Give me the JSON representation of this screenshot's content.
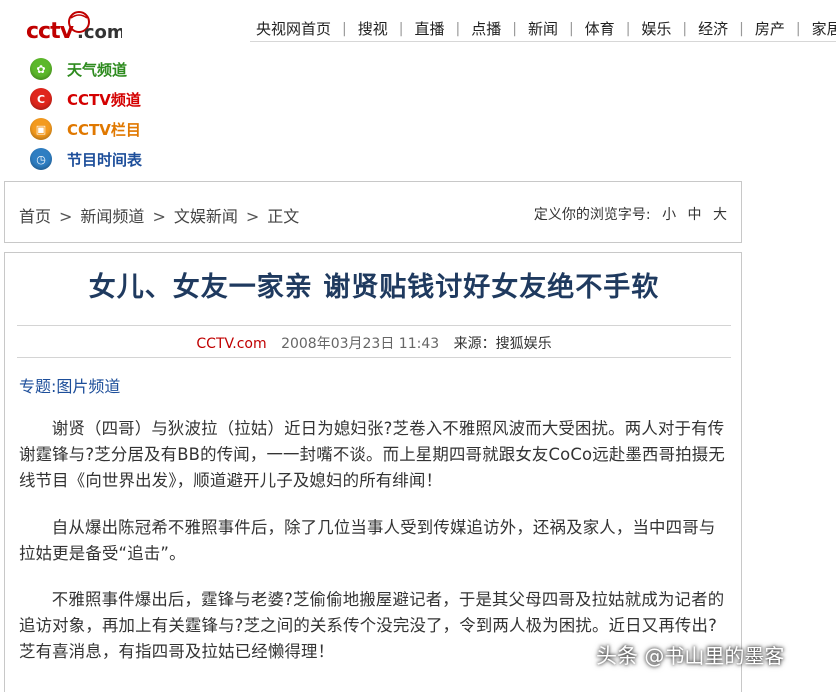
{
  "logo": {
    "text": "cctv.com",
    "color": "#c00000"
  },
  "top_nav": {
    "items": [
      "央视网首页",
      "搜视",
      "直播",
      "点播",
      "新闻",
      "体育",
      "娱乐",
      "经济",
      "房产",
      "家居"
    ],
    "separator": "|"
  },
  "side_links": [
    {
      "label": "天气频道",
      "icon": "weather-icon",
      "color": "#2e8b1f",
      "icon_color": "#5cb82a"
    },
    {
      "label": "CCTV频道",
      "icon": "cctv-channel-icon",
      "color": "#d40000",
      "icon_color": "#e0261c"
    },
    {
      "label": "CCTV栏目",
      "icon": "cctv-column-icon",
      "color": "#e07800",
      "icon_color": "#f39a1e"
    },
    {
      "label": "节目时间表",
      "icon": "schedule-icon",
      "color": "#1d4e9a",
      "icon_color": "#2f7ec2"
    }
  ],
  "breadcrumb": {
    "items": [
      "首页",
      "新闻频道",
      "文娱新闻",
      "正文"
    ],
    "separator": ">"
  },
  "font_size": {
    "label": "定义你的浏览字号:",
    "options": [
      "小",
      "中",
      "大"
    ]
  },
  "article": {
    "title": "女儿、女友一家亲 谢贤贴钱讨好女友绝不手软",
    "source_site": "CCTV.com",
    "datetime": "2008年03月23日 11:43",
    "source_label": "来源：搜狐娱乐",
    "topic_label": "专题:",
    "topic_link": "图片频道",
    "paragraphs": [
      "谢贤（四哥）与狄波拉（拉姑）近日为媳妇张?芝卷入不雅照风波而大受困扰。两人对于有传谢霆锋与?芝分居及有BB的传闻，一一封嘴不谈。而上星期四哥就跟女友CoCo远赴墨西哥拍摄无线节目《向世界出发》，顺道避开儿子及媳妇的所有绯闻！",
      "自从爆出陈冠希不雅照事件后，除了几位当事人受到传媒追访外，还祸及家人，当中四哥与拉姑更是备受“追击”。",
      "不雅照事件爆出后，霆锋与老婆?芝偷偷地搬屋避记者，于是其父母四哥及拉姑就成为记者的追访对象，再加上有关霆锋与?芝之间的关系传个没完没了，令到两人极为困扰。近日又再传出?芝有喜消息，有指四哥及拉姑已经懒得理！"
    ]
  },
  "watermark": {
    "prefix": "头条",
    "handle": "@书山里的墨客"
  }
}
